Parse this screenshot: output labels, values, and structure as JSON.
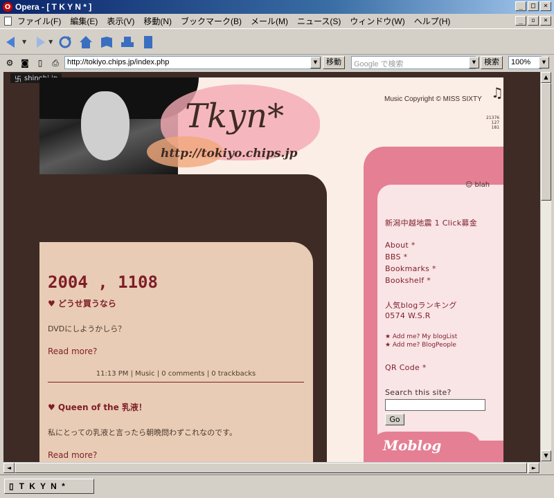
{
  "window": {
    "title": "Opera - [ T K Y N * ]",
    "app_icon": "O"
  },
  "menu": [
    "ファイル(F)",
    "編集(E)",
    "表示(V)",
    "移動(N)",
    "ブックマーク(B)",
    "メール(M)",
    "ニュース(S)",
    "ウィンドウ(W)",
    "ヘルプ(H)"
  ],
  "address": {
    "url": "http://tokiyo.chips.jp/index.php",
    "go_label": "移動",
    "search_placeholder": "Google で検索",
    "search_label": "検索",
    "zoom": "100%"
  },
  "tab": {
    "label": "T K Y N *"
  },
  "page": {
    "badge": "shinobi.jp",
    "logo": "Tkyn*",
    "logo_url": "http://tokiyo.chips.jp",
    "copyright": "Music Copyright © MISS SIXTY",
    "counter": [
      "21376",
      "127",
      "181"
    ],
    "blah": "blah",
    "posts": [
      {
        "date": "2004 , 1108",
        "title": "♥ どうせ買うなら",
        "text": "DVDにしようかしら？",
        "readmore": "Read more?",
        "meta": "11:13 PM | Music | 0 comments | 0 trackbacks"
      },
      {
        "title": "♥ Queen of the 乳液！",
        "text": "私にとっての乳液と言ったら朝晩問わずこれなのです。",
        "readmore": "Read more?"
      }
    ],
    "sidebar": {
      "donation": "新潟中越地震 1 Click募金",
      "links": [
        "About *",
        "BBS *",
        "Bookmarks *",
        "Bookshelf *"
      ],
      "ranking": "人気blogランキング",
      "wsr": "0574 W.S.R",
      "bloglist": "★ Add me? My blogList",
      "blogpeople": "★ Add me? BlogPeople",
      "qr": "QR Code *",
      "search_label": "Search this site?",
      "go": "Go",
      "moblog": "Moblog"
    }
  }
}
